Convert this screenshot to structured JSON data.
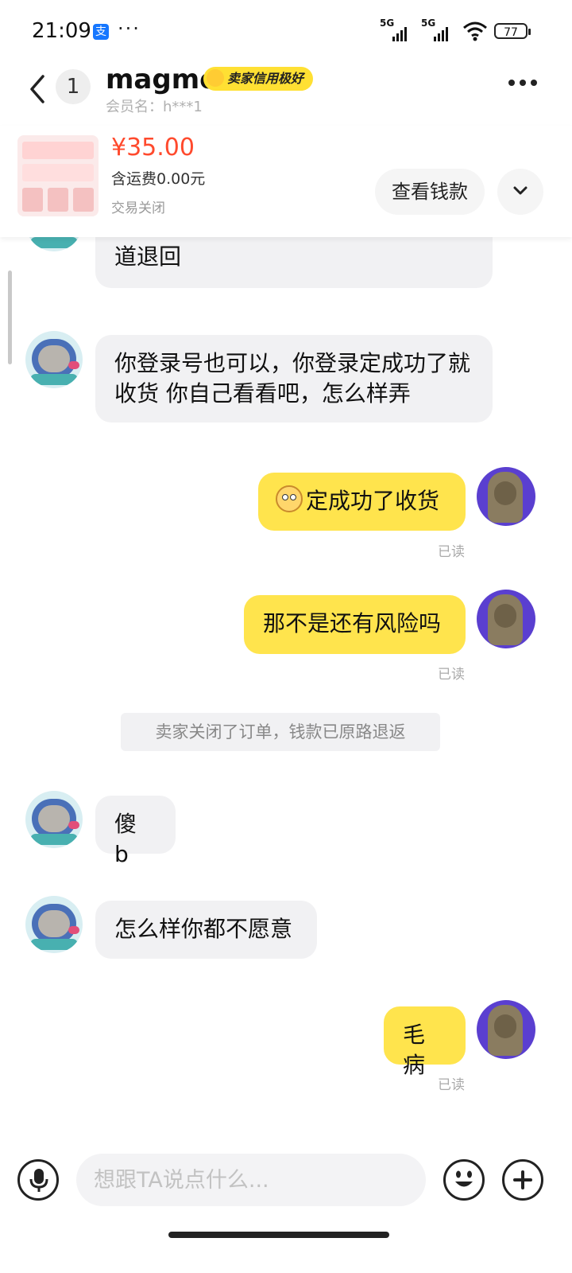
{
  "status_bar": {
    "time": "21:09",
    "alipay_icon_label": "支",
    "more_dots": "···",
    "signal_1_label": "5G",
    "signal_2_label": "5G",
    "battery_level": "77"
  },
  "header": {
    "unread_count": "1",
    "contact_name": "magmo",
    "credit_badge": "卖家信用极好",
    "member_name": "会员名：h***1"
  },
  "product": {
    "price": "¥35.00",
    "shipping": "含运费0.00元",
    "status": "交易关闭",
    "view_payment_label": "查看钱款"
  },
  "messages": [
    {
      "from": "seller",
      "text": "道退回"
    },
    {
      "from": "seller",
      "text": "你登录号也可以，你登录定成功了就收货 你自己看看吧，怎么样弄"
    },
    {
      "from": "me",
      "text": "定成功了收货",
      "read": "已读"
    },
    {
      "from": "me",
      "text": "那不是还有风险吗",
      "read": "已读"
    },
    {
      "from": "system",
      "text": "卖家关闭了订单，钱款已原路退返"
    },
    {
      "from": "seller",
      "text": "傻 b"
    },
    {
      "from": "seller",
      "text": "怎么样你都不愿意"
    },
    {
      "from": "me",
      "text": "毛病",
      "read": "已读"
    }
  ],
  "input": {
    "placeholder": "想跟TA说点什么..."
  },
  "colors": {
    "outgoing_bubble": "#ffe44d",
    "incoming_bubble": "#f1f1f3",
    "price": "#ff4a2d",
    "credit_badge": "#ffe033"
  },
  "icons": {
    "back": "chevron-left-icon",
    "more": "more-horizontal-icon",
    "expand": "chevron-down-icon",
    "voice": "microphone-icon",
    "emoji": "smiley-icon",
    "plus": "plus-circle-icon"
  }
}
